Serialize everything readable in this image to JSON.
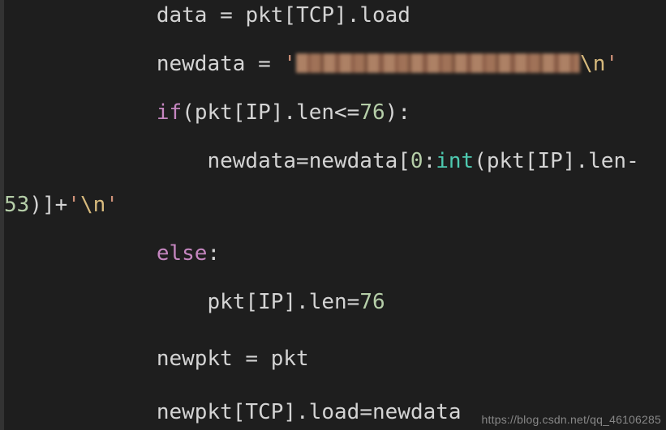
{
  "code": {
    "indent": "            ",
    "indent_more": "                ",
    "wrap_indent": "",
    "l1": {
      "lhs": "data",
      "eq": " = ",
      "obj": "pkt",
      "lb": "[",
      "idx": "TCP",
      "rb": "]",
      "dot": ".",
      "attr": "load"
    },
    "l2": {
      "lhs": "newdata",
      "eq": " = ",
      "q": "'",
      "tail_esc": "\\n",
      "q2": "'"
    },
    "l3": {
      "kw": "if",
      "lp": "(",
      "obj": "pkt",
      "lb": "[",
      "idx": "IP",
      "rb": "]",
      "dot": ".",
      "attr": "len",
      "op": "<=",
      "num": "76",
      "rp": ")",
      "colon": ":"
    },
    "l4": {
      "lhs": "newdata",
      "eq": "=",
      "rhs": "newdata",
      "lb": "[",
      "z": "0",
      "colon": ":",
      "fn": "int",
      "lp": "(",
      "obj": "pkt",
      "lb2": "[",
      "idx": "IP",
      "rb2": "]",
      "dot": ".",
      "attr": "len",
      "minus": "-"
    },
    "l4b": {
      "num": "53",
      "rp": ")",
      "rb": "]",
      "plus": "+",
      "q": "'",
      "esc": "\\n",
      "q2": "'"
    },
    "l5": {
      "kw": "else",
      "colon": ":"
    },
    "l6": {
      "obj": "pkt",
      "lb": "[",
      "idx": "IP",
      "rb": "]",
      "dot": ".",
      "attr": "len",
      "eq": "=",
      "num": "76"
    },
    "l7": {
      "lhs": "newpkt",
      "eq": " = ",
      "rhs": "pkt"
    },
    "l8": {
      "lhs": "newpkt",
      "lb": "[",
      "idx": "TCP",
      "rb": "]",
      "dot": ".",
      "attr": "load",
      "eq": "=",
      "rhs": "newdata"
    }
  },
  "watermark": "https://blog.csdn.net/qq_46106285"
}
